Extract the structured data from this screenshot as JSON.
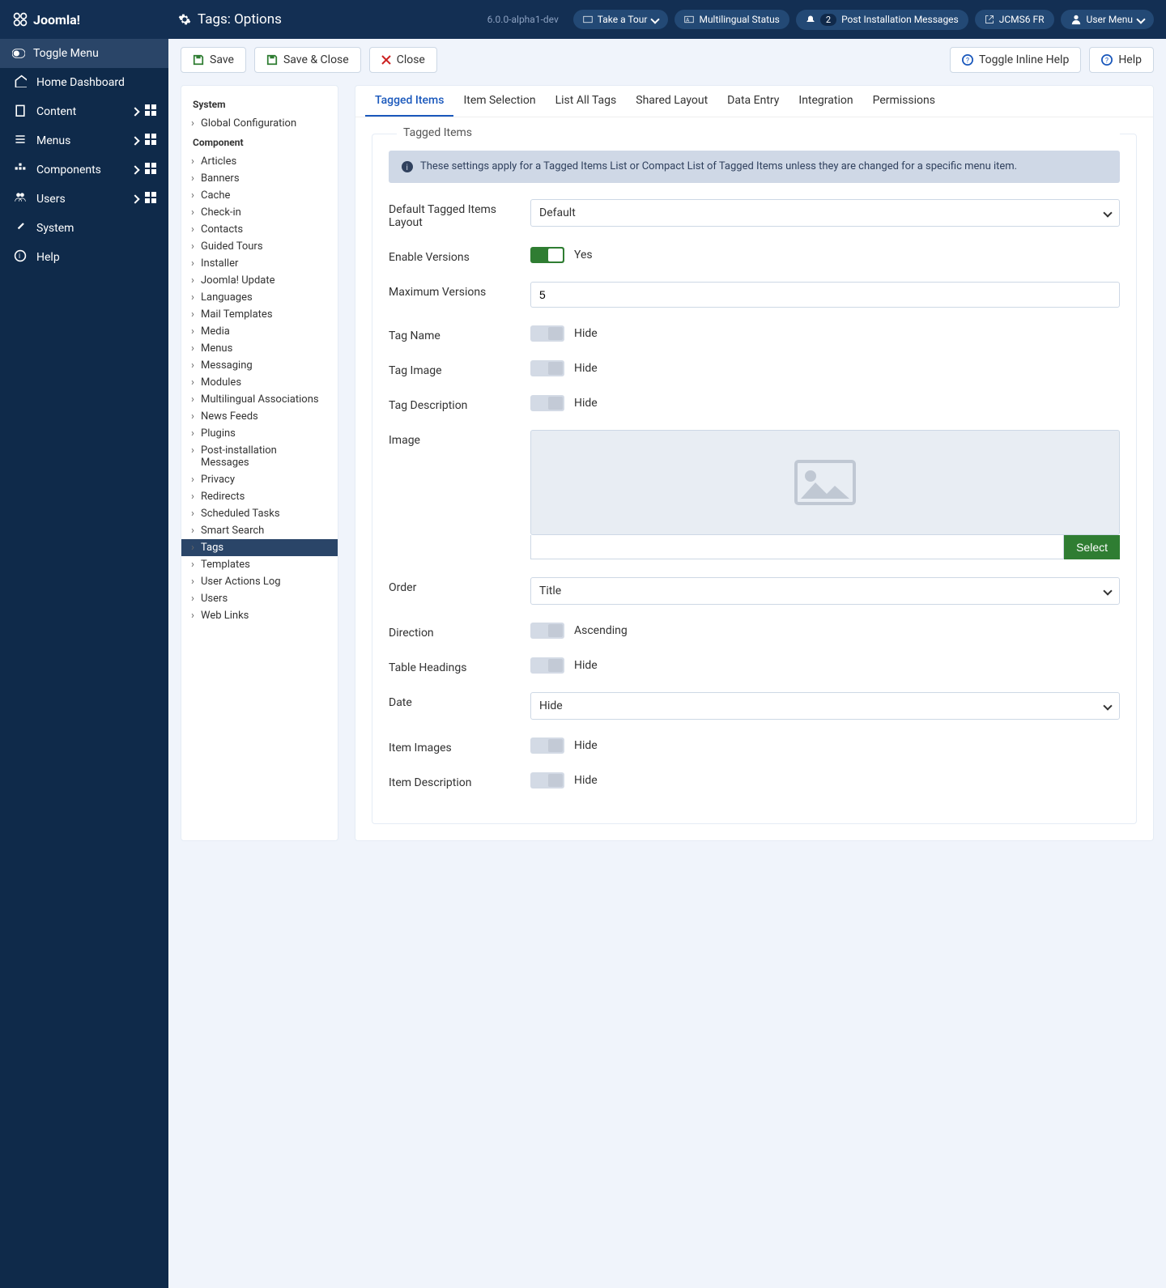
{
  "brand": "Joomla!",
  "page_title": "Tags: Options",
  "version": "6.0.0-alpha1-dev",
  "top_pills": {
    "take_tour": "Take a Tour",
    "multilingual": "Multilingual Status",
    "post_install_count": "2",
    "post_install": "Post Installation Messages",
    "site": "JCMS6 FR",
    "user_menu": "User Menu"
  },
  "sidebar": {
    "toggle": "Toggle Menu",
    "items": [
      {
        "label": "Home Dashboard",
        "expandable": false
      },
      {
        "label": "Content",
        "expandable": true
      },
      {
        "label": "Menus",
        "expandable": true
      },
      {
        "label": "Components",
        "expandable": true
      },
      {
        "label": "Users",
        "expandable": true
      },
      {
        "label": "System",
        "expandable": false
      },
      {
        "label": "Help",
        "expandable": false
      }
    ]
  },
  "toolbar": {
    "save": "Save",
    "save_close": "Save & Close",
    "close": "Close",
    "toggle_help": "Toggle Inline Help",
    "help": "Help"
  },
  "config_nav": {
    "system_header": "System",
    "system_items": [
      "Global Configuration"
    ],
    "component_header": "Component",
    "component_items": [
      "Articles",
      "Banners",
      "Cache",
      "Check-in",
      "Contacts",
      "Guided Tours",
      "Installer",
      "Joomla! Update",
      "Languages",
      "Mail Templates",
      "Media",
      "Menus",
      "Messaging",
      "Modules",
      "Multilingual Associations",
      "News Feeds",
      "Plugins",
      "Post-installation Messages",
      "Privacy",
      "Redirects",
      "Scheduled Tasks",
      "Smart Search",
      "Tags",
      "Templates",
      "User Actions Log",
      "Users",
      "Web Links"
    ],
    "active": "Tags"
  },
  "tabs": [
    "Tagged Items",
    "Item Selection",
    "List All Tags",
    "Shared Layout",
    "Data Entry",
    "Integration",
    "Permissions"
  ],
  "active_tab": "Tagged Items",
  "fieldset_title": "Tagged Items",
  "info_text": "These settings apply for a Tagged Items List or Compact List of Tagged Items unless they are changed for a specific menu item.",
  "fields": {
    "default_layout": {
      "label": "Default Tagged Items Layout",
      "value": "Default"
    },
    "enable_versions": {
      "label": "Enable Versions",
      "value": "Yes",
      "on": true
    },
    "max_versions": {
      "label": "Maximum Versions",
      "value": "5"
    },
    "tag_name": {
      "label": "Tag Name",
      "value": "Hide",
      "on": false
    },
    "tag_image": {
      "label": "Tag Image",
      "value": "Hide",
      "on": false
    },
    "tag_description": {
      "label": "Tag Description",
      "value": "Hide",
      "on": false
    },
    "image": {
      "label": "Image",
      "select_btn": "Select"
    },
    "order": {
      "label": "Order",
      "value": "Title"
    },
    "direction": {
      "label": "Direction",
      "value": "Ascending",
      "on": false
    },
    "table_headings": {
      "label": "Table Headings",
      "value": "Hide",
      "on": false
    },
    "date": {
      "label": "Date",
      "value": "Hide"
    },
    "item_images": {
      "label": "Item Images",
      "value": "Hide",
      "on": false
    },
    "item_description": {
      "label": "Item Description",
      "value": "Hide",
      "on": false
    }
  }
}
